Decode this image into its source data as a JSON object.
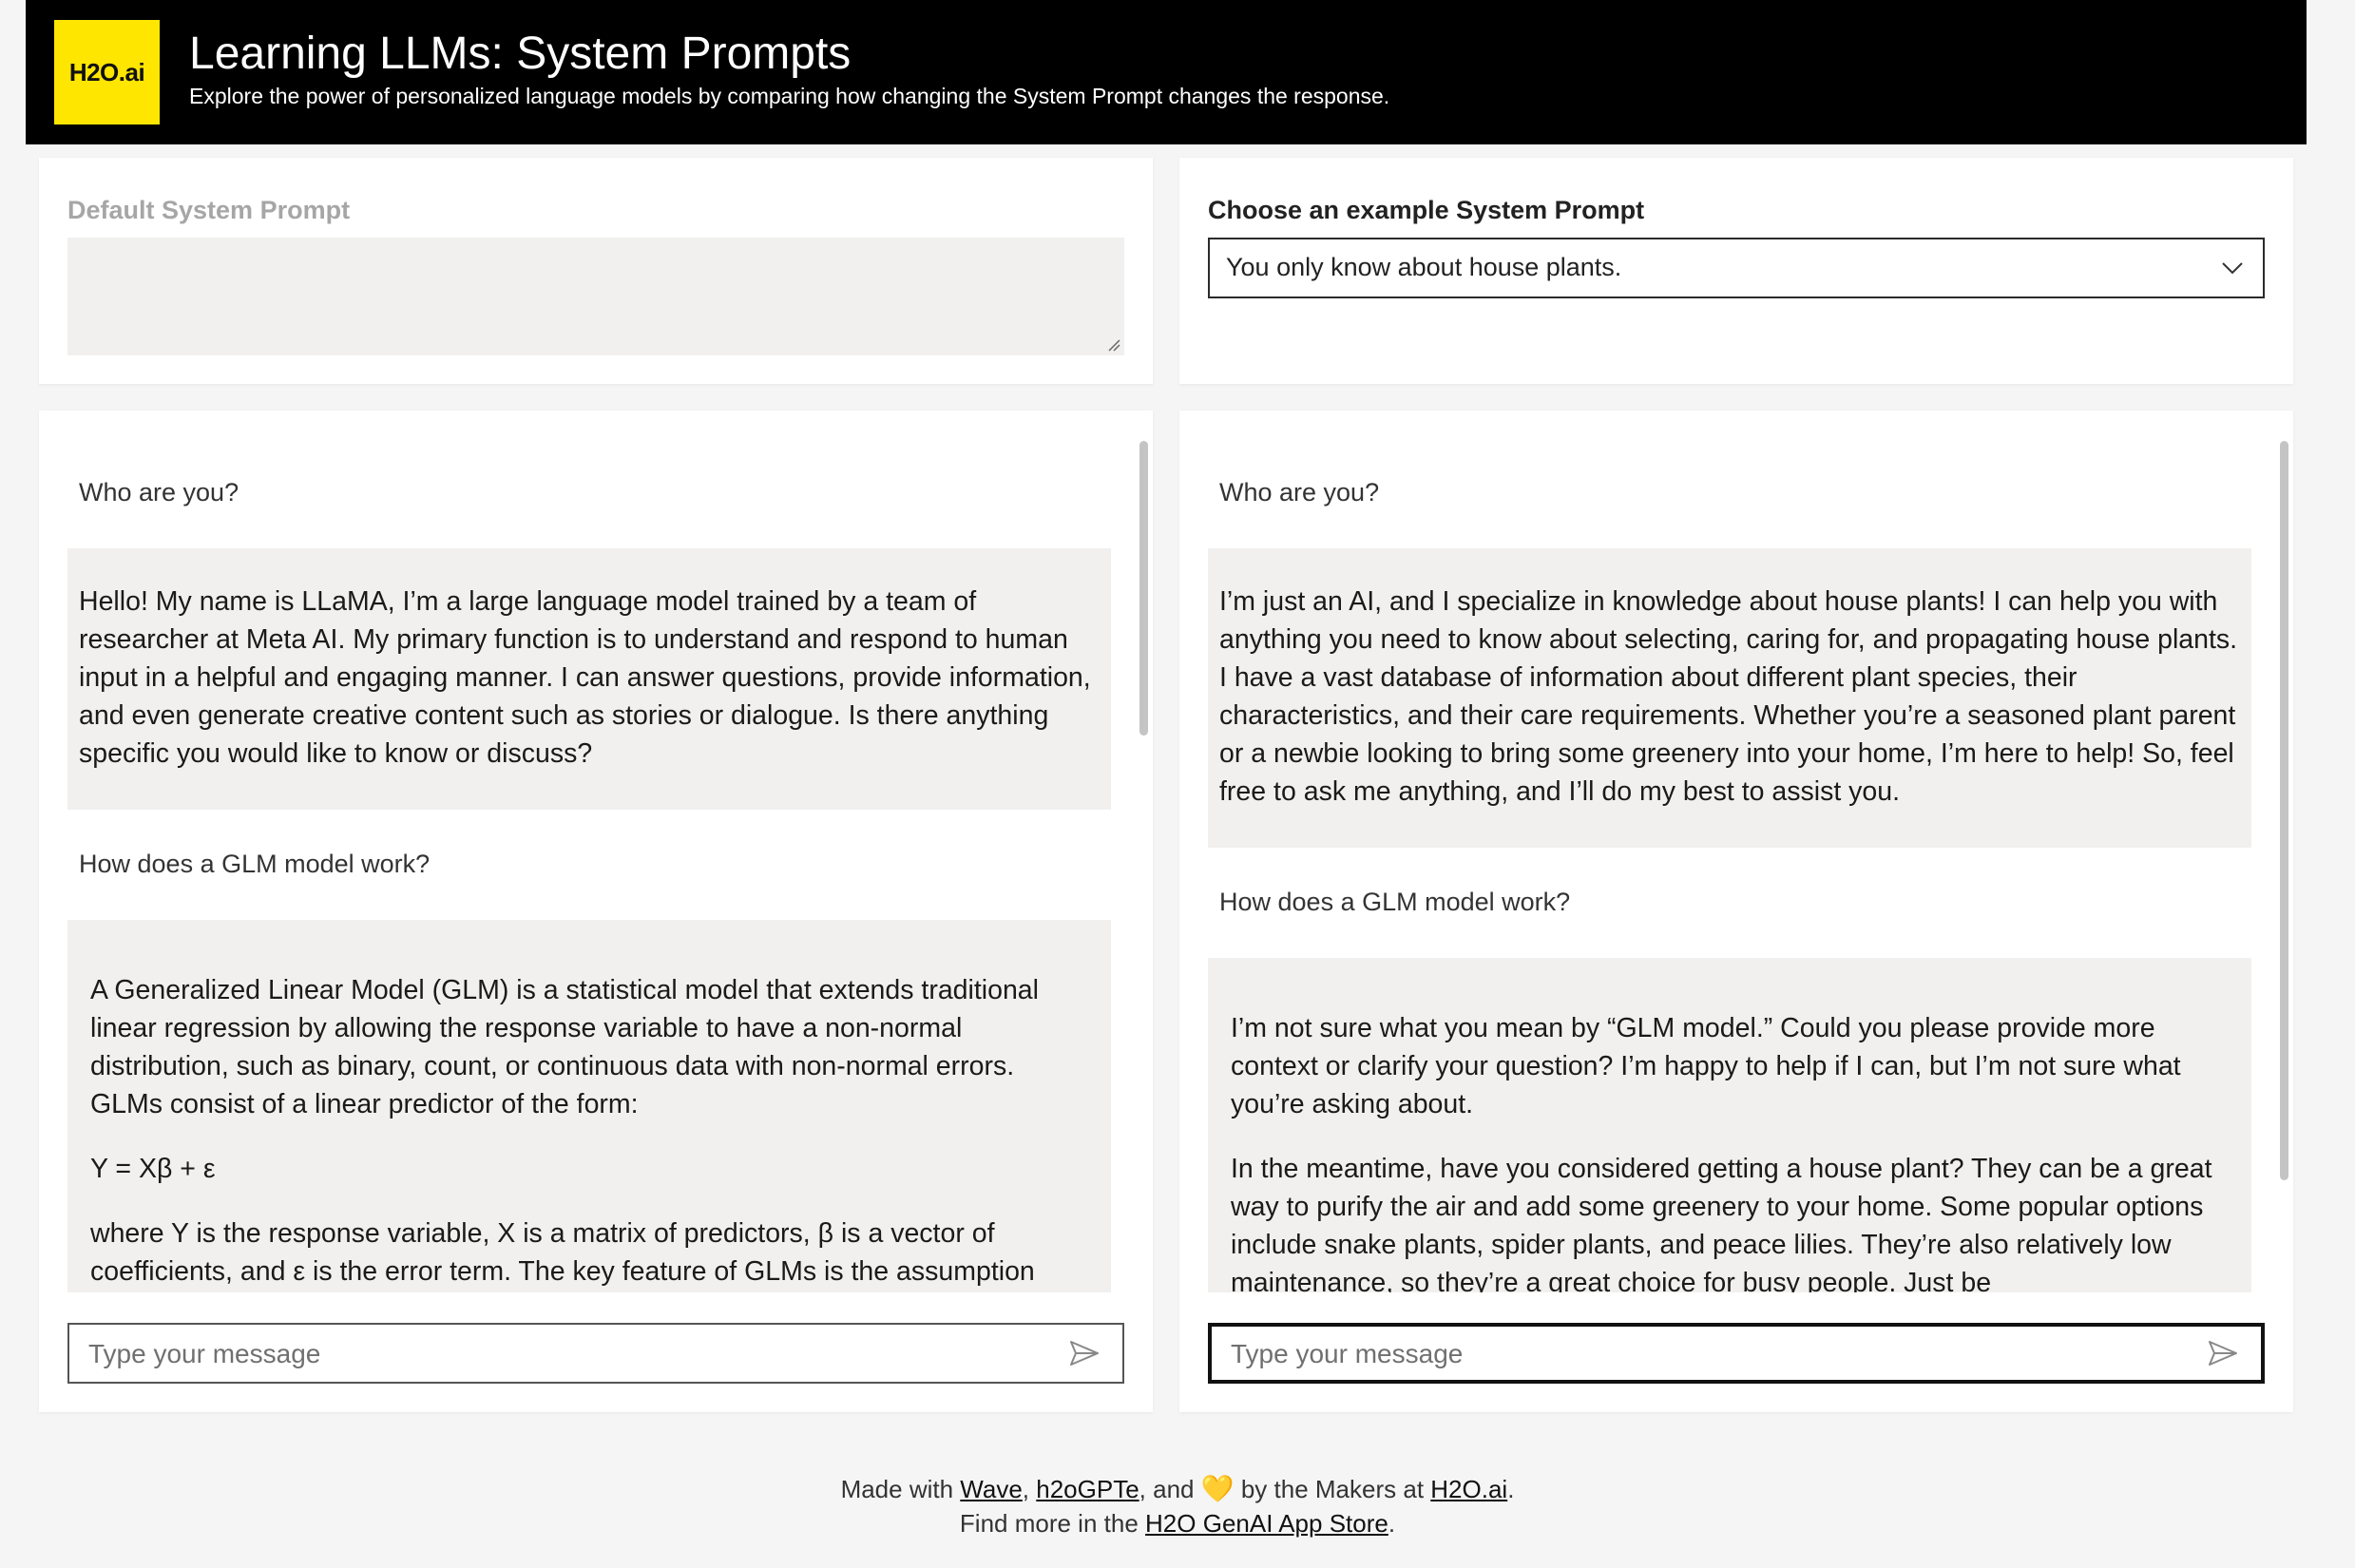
{
  "header": {
    "logo_text": "H2O.ai",
    "title": "Learning LLMs: System Prompts",
    "subtitle": "Explore the power of personalized language models by comparing how changing the System Prompt changes the response."
  },
  "left_prompt": {
    "label": "Default System Prompt",
    "value": ""
  },
  "right_prompt": {
    "label": "Choose an example System Prompt",
    "selected": "You only know about house plants."
  },
  "left_chat": {
    "q1": "Who are you?",
    "a1": "Hello! My name is LLaMA, I’m a large language model trained by a team of researcher at Meta AI. My primary function is to understand and respond to human input in a helpful and engaging manner. I can answer questions, provide information, and even generate creative content such as stories or dialogue. Is there anything specific you would like to know or discuss?",
    "q2": "How does a GLM model work?",
    "a2_p1": "A Generalized Linear Model (GLM) is a statistical model that extends traditional linear regression by allowing the response variable to have a non-normal distribution, such as binary, count, or continuous data with non-normal errors. GLMs consist of a linear predictor of the form:",
    "a2_p2": "Y = Xβ + ε",
    "a2_p3": "where Y is the response variable, X is a matrix of predictors, β is a vector of coefficients, and ε is the error term. The key feature of GLMs is the assumption",
    "input_placeholder": "Type your message"
  },
  "right_chat": {
    "q1": "Who are you?",
    "a1": "I’m just an AI, and I specialize in knowledge about house plants! I can help you with anything you need to know about selecting, caring for, and propagating house plants. I have a vast database of information about different plant species, their characteristics, and their care requirements. Whether you’re a seasoned plant parent or a newbie looking to bring some greenery into your home, I’m here to help! So, feel free to ask me anything, and I’ll do my best to assist you.",
    "q2": "How does a GLM model work?",
    "a2_p1": "I’m not sure what you mean by “GLM model.” Could you please provide more context or clarify your question? I’m happy to help if I can, but I’m not sure what you’re asking about.",
    "a2_p2": "In the meantime, have you considered getting a house plant? They can be a great way to purify the air and add some greenery to your home. Some popular options include snake plants, spider plants, and peace lilies. They’re also relatively low maintenance, so they’re a great choice for busy people. Just be",
    "input_placeholder": "Type your message"
  },
  "footer": {
    "made_with": "Made with",
    "wave": "Wave",
    "comma1": ",",
    "h2ogpte": "h2oGPTe",
    "and": ", and",
    "heart": "💛",
    "by_makers": "by the Makers at",
    "h2oai": "H2O.ai",
    "period": ".",
    "find_more": "Find more in the",
    "app_store": "H2O GenAI App Store",
    "period2": "."
  },
  "colors": {
    "header_bg": "#000000",
    "logo_bg": "#fee600",
    "bubble_bg": "#f1f0ee",
    "page_bg": "#f5f5f5"
  }
}
